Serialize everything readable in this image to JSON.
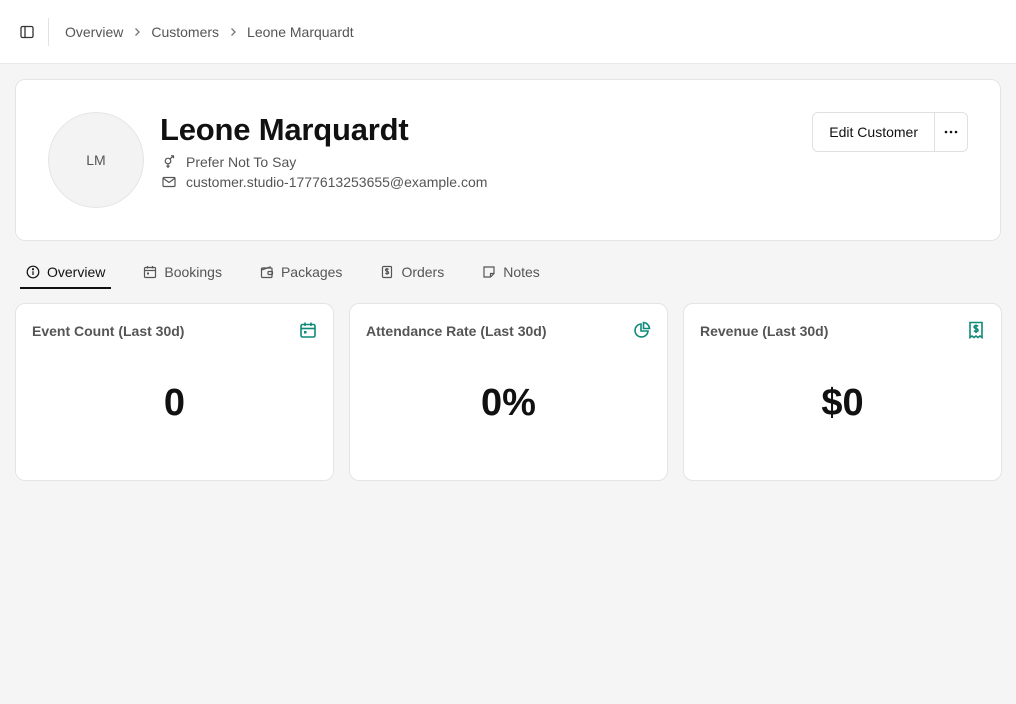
{
  "breadcrumb": {
    "items": [
      "Overview",
      "Customers",
      "Leone Marquardt"
    ]
  },
  "customer": {
    "initials": "LM",
    "name": "Leone Marquardt",
    "gender": "Prefer Not To Say",
    "email": "customer.studio-1777613253655@example.com"
  },
  "actions": {
    "edit_label": "Edit Customer",
    "more_label": "···"
  },
  "tabs": [
    {
      "label": "Overview",
      "icon": "info-icon",
      "active": true
    },
    {
      "label": "Bookings",
      "icon": "calendar-icon",
      "active": false
    },
    {
      "label": "Packages",
      "icon": "wallet-icon",
      "active": false
    },
    {
      "label": "Orders",
      "icon": "dollar-receipt-icon",
      "active": false
    },
    {
      "label": "Notes",
      "icon": "sticky-note-icon",
      "active": false
    }
  ],
  "stats": [
    {
      "title": "Event Count (Last 30d)",
      "value": "0",
      "icon": "calendar-icon"
    },
    {
      "title": "Attendance Rate (Last 30d)",
      "value": "0%",
      "icon": "pie-chart-icon"
    },
    {
      "title": "Revenue (Last 30d)",
      "value": "$0",
      "icon": "receipt-icon"
    }
  ],
  "colors": {
    "accent": "#0f8a78",
    "text": "#111111",
    "muted": "#555555"
  }
}
